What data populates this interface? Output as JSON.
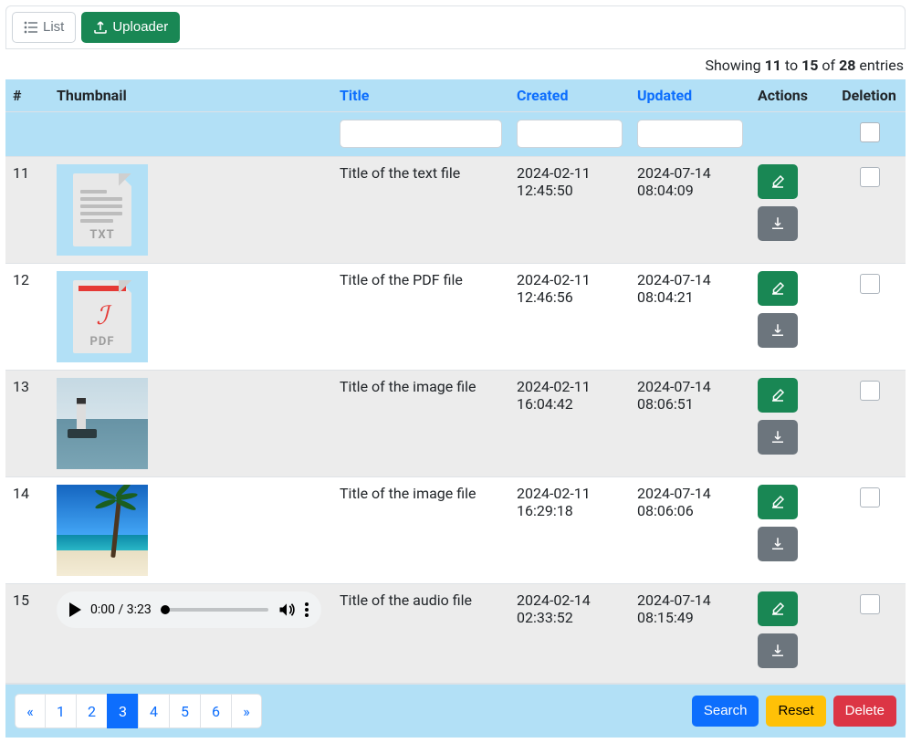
{
  "topbar": {
    "list_label": "List",
    "uploader_label": "Uploader"
  },
  "summary": {
    "prefix": "Showing ",
    "from": "11",
    "mid1": " to ",
    "to": "15",
    "mid2": " of ",
    "total": "28",
    "suffix": " entries"
  },
  "headers": {
    "num": "#",
    "thumbnail": "Thumbnail",
    "title": "Title",
    "created": "Created",
    "updated": "Updated",
    "actions": "Actions",
    "deletion": "Deletion"
  },
  "filters": {
    "title": "",
    "created": "",
    "updated": ""
  },
  "rows": [
    {
      "num": "11",
      "thumb_type": "txt",
      "ext_label": "TXT",
      "title": "Title of the text file",
      "created": "2024-02-11 12:45:50",
      "updated": "2024-07-14 08:04:09"
    },
    {
      "num": "12",
      "thumb_type": "pdf",
      "ext_label": "PDF",
      "title": "Title of the PDF file",
      "created": "2024-02-11 12:46:56",
      "updated": "2024-07-14 08:04:21"
    },
    {
      "num": "13",
      "thumb_type": "image_lighthouse",
      "title": "Title of the image file",
      "created": "2024-02-11 16:04:42",
      "updated": "2024-07-14 08:06:51"
    },
    {
      "num": "14",
      "thumb_type": "image_beach",
      "title": "Title of the image file",
      "created": "2024-02-11 16:29:18",
      "updated": "2024-07-14 08:06:06"
    },
    {
      "num": "15",
      "thumb_type": "audio",
      "audio_time": "0:00 / 3:23",
      "title": "Title of the audio file",
      "created": "2024-02-14 02:33:52",
      "updated": "2024-07-14 08:15:49"
    }
  ],
  "pagination": {
    "prev": "«",
    "pages": [
      "1",
      "2",
      "3",
      "4",
      "5",
      "6"
    ],
    "active_index": 2,
    "next": "»"
  },
  "footer": {
    "search": "Search",
    "reset": "Reset",
    "delete": "Delete"
  }
}
